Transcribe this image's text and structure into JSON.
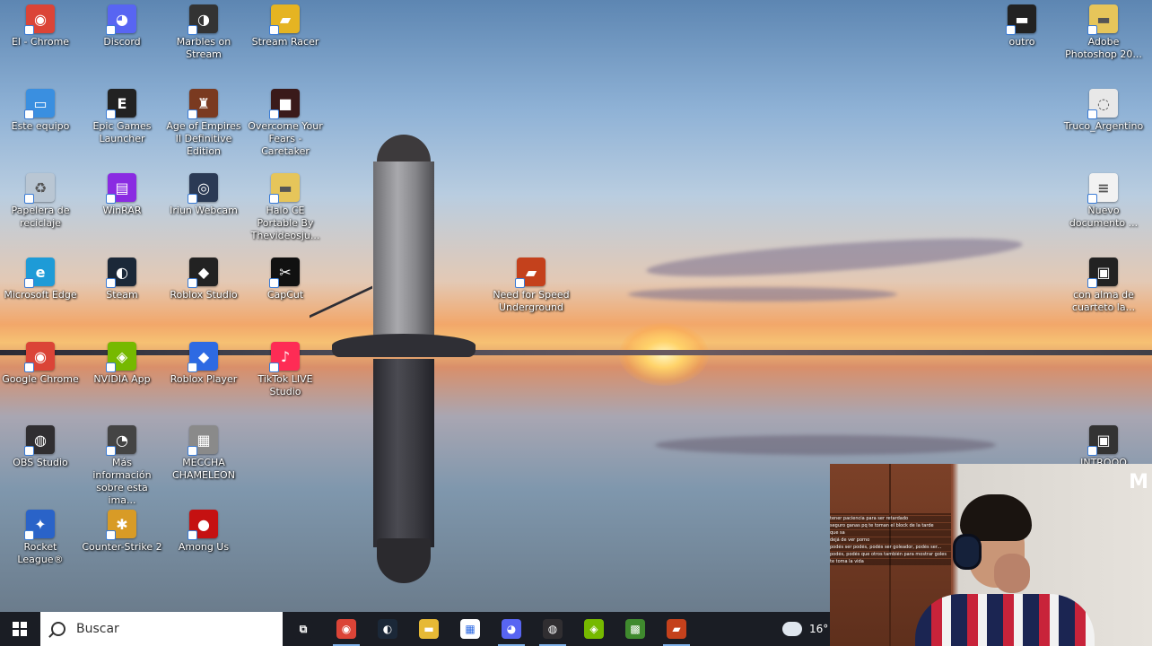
{
  "desktop": {
    "icons": [
      {
        "label": "El - Chrome",
        "icon": "chrome-icon",
        "color": "#db4437",
        "glyph": "◉"
      },
      {
        "label": "Discord",
        "icon": "discord-icon",
        "color": "#5865f2",
        "glyph": "◕"
      },
      {
        "label": "Marbles on Stream",
        "icon": "marbles-icon",
        "color": "#333333",
        "glyph": "◑"
      },
      {
        "label": "Stream Racer",
        "icon": "stream-racer-icon",
        "color": "#e5b422",
        "glyph": "▰"
      },
      {
        "label": "Este equipo",
        "icon": "computer-icon",
        "color": "#3a8fe0",
        "glyph": "▭"
      },
      {
        "label": "Epic Games Launcher",
        "icon": "epic-games-icon",
        "color": "#222222",
        "glyph": "E"
      },
      {
        "label": "Age of Empires II Definitive Edition",
        "icon": "age-of-empires-icon",
        "color": "#7a3a20",
        "glyph": "♜"
      },
      {
        "label": "Overcome Your Fears - Caretaker",
        "icon": "caretaker-icon",
        "color": "#3a1a1a",
        "glyph": "■"
      },
      {
        "label": "Papelera de reciclaje",
        "icon": "recycle-bin-icon",
        "color": "#b9c6d3",
        "glyph": "♻"
      },
      {
        "label": "WinRAR",
        "icon": "winrar-icon",
        "color": "#8a2be2",
        "glyph": "▤"
      },
      {
        "label": "Iriun Webcam",
        "icon": "iriun-webcam-icon",
        "color": "#2b3a55",
        "glyph": "◎"
      },
      {
        "label": "Halo CE Portable By Thevideosju...",
        "icon": "folder-icon",
        "color": "#e6c55a",
        "glyph": "▬"
      },
      {
        "label": "Microsoft Edge",
        "icon": "edge-icon",
        "color": "#1e9bd7",
        "glyph": "e"
      },
      {
        "label": "Steam",
        "icon": "steam-icon",
        "color": "#1b2838",
        "glyph": "◐"
      },
      {
        "label": "Roblox Studio",
        "icon": "roblox-studio-icon",
        "color": "#222222",
        "glyph": "◆"
      },
      {
        "label": "CapCut",
        "icon": "capcut-icon",
        "color": "#111111",
        "glyph": "✂"
      },
      {
        "label": "Google Chrome",
        "icon": "google-chrome-icon",
        "color": "#db4437",
        "glyph": "◉"
      },
      {
        "label": "NVIDIA App",
        "icon": "nvidia-icon",
        "color": "#76b900",
        "glyph": "◈"
      },
      {
        "label": "Roblox Player",
        "icon": "roblox-player-icon",
        "color": "#2d6ae3",
        "glyph": "◆"
      },
      {
        "label": "TikTok LIVE Studio",
        "icon": "tiktok-live-icon",
        "color": "#fe2c55",
        "glyph": "♪"
      },
      {
        "label": "OBS Studio",
        "icon": "obs-icon",
        "color": "#302e31",
        "glyph": "◍"
      },
      {
        "label": "Más información sobre esta ima...",
        "icon": "info-icon",
        "color": "#444444",
        "glyph": "◔"
      },
      {
        "label": "MECCHA CHAMELEON",
        "icon": "meccha-chameleon-icon",
        "color": "#8a8a8a",
        "glyph": "▦"
      },
      {
        "label": "Rocket League®",
        "icon": "rocket-league-icon",
        "color": "#2a63c8",
        "glyph": "✦"
      },
      {
        "label": "Counter-Strike 2",
        "icon": "counter-strike-icon",
        "color": "#d89b26",
        "glyph": "✱"
      },
      {
        "label": "Among Us",
        "icon": "among-us-icon",
        "color": "#c51111",
        "glyph": "●"
      },
      {
        "label": "Need for Speed Underground",
        "icon": "need-for-speed-icon",
        "color": "#c4411c",
        "glyph": "▰"
      },
      {
        "label": "outro",
        "icon": "outro-video-icon",
        "color": "#222222",
        "glyph": "▬"
      },
      {
        "label": "Adobe Photoshop 20...",
        "icon": "folder-icon",
        "color": "#e6c55a",
        "glyph": "▬"
      },
      {
        "label": "Truco_Argentino",
        "icon": "document-icon",
        "color": "#e8e8e8",
        "glyph": "◌"
      },
      {
        "label": "Nuevo documento ...",
        "icon": "text-file-icon",
        "color": "#f2f2f2",
        "glyph": "≡"
      },
      {
        "label": "con alma de cuarteto la...",
        "icon": "video-file-icon",
        "color": "#222222",
        "glyph": "▣"
      },
      {
        "label": "INTROOO",
        "icon": "video-file-icon",
        "color": "#333333",
        "glyph": "▣"
      }
    ]
  },
  "taskbar": {
    "search_placeholder": "Buscar",
    "apps": [
      {
        "name": "task-view",
        "icon": "task-view-icon",
        "color": "#1a1d24",
        "glyph": "⧉",
        "active": false
      },
      {
        "name": "chrome",
        "icon": "chrome-icon",
        "color": "#db4437",
        "glyph": "◉",
        "active": true
      },
      {
        "name": "steam",
        "icon": "steam-icon",
        "color": "#1b2838",
        "glyph": "◐",
        "active": false
      },
      {
        "name": "file-explorer",
        "icon": "folder-icon",
        "color": "#e6b935",
        "glyph": "▬",
        "active": false
      },
      {
        "name": "microsoft-store",
        "icon": "store-icon",
        "color": "#ffffff",
        "glyph": "▦",
        "active": false
      },
      {
        "name": "discord",
        "icon": "discord-icon",
        "color": "#5865f2",
        "glyph": "◕",
        "active": true
      },
      {
        "name": "obs",
        "icon": "obs-icon",
        "color": "#302e31",
        "glyph": "◍",
        "active": true
      },
      {
        "name": "nvidia",
        "icon": "nvidia-icon",
        "color": "#76b900",
        "glyph": "◈",
        "active": false
      },
      {
        "name": "minecraft",
        "icon": "minecraft-icon",
        "color": "#3f8a2e",
        "glyph": "▩",
        "active": false
      },
      {
        "name": "need-for-speed",
        "icon": "need-for-speed-icon",
        "color": "#c4411c",
        "glyph": "▰",
        "active": true
      }
    ],
    "weather_temp": "16°"
  },
  "webcam": {
    "overlay_letter": "M",
    "chat_lines": [
      "tener paciencia para ser retardado",
      "seguro ganas pq te toman el block de la tarde",
      "que sa",
      "dejá de ver porno",
      "podés ser podés, podés ser goleador, podés ser...",
      "podés, podés que otros también para mostrar goles",
      "te toma la vida"
    ]
  }
}
